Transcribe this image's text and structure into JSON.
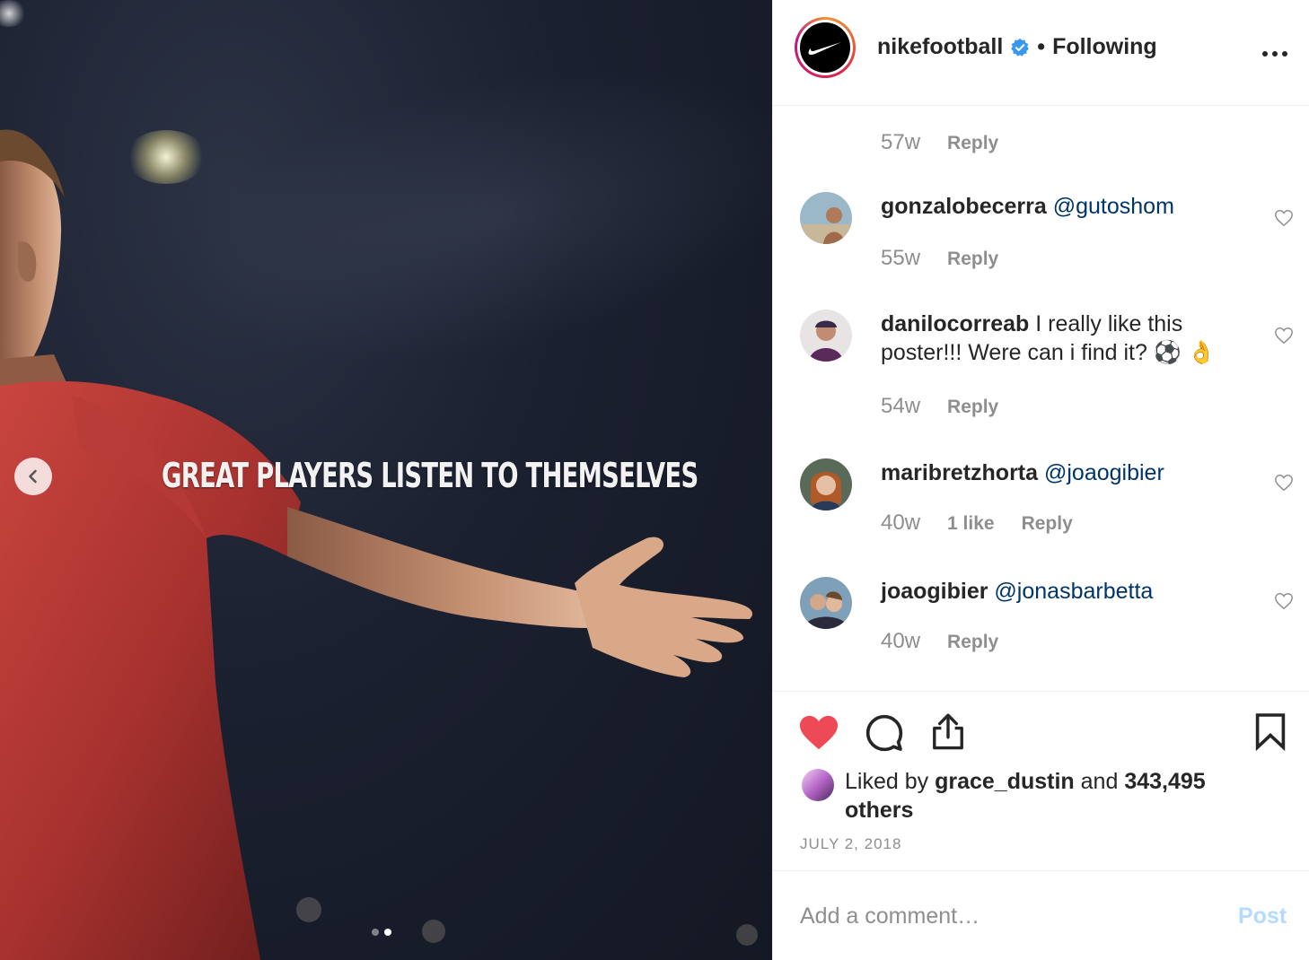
{
  "media": {
    "poster_text": "GREAT PLAYERS LISTEN TO THEMSELVES",
    "prev_icon": "chevron-left-icon",
    "carousel": {
      "count": 2,
      "active_index": 2
    }
  },
  "header": {
    "username": "nikefootball",
    "verified_icon": "verified-badge-icon",
    "separator": "•",
    "follow_status": "Following",
    "more_icon": "more-options-icon"
  },
  "comments": {
    "top_meta": {
      "age": "57w",
      "reply": "Reply"
    },
    "items": [
      {
        "username": "gonzalobecerra",
        "mention": "@gutoshom",
        "text": "",
        "age": "55w",
        "likes": "",
        "reply": "Reply"
      },
      {
        "username": "danilocorreab",
        "mention": "",
        "text": "I really like this poster!!! Were can i find it? ⚽ 👌",
        "age": "54w",
        "likes": "",
        "reply": "Reply"
      },
      {
        "username": "maribretzhorta",
        "mention": "@joaogibier",
        "text": "",
        "age": "40w",
        "likes": "1 like",
        "reply": "Reply"
      },
      {
        "username": "joaogibier",
        "mention": "@jonasbarbetta",
        "text": "",
        "age": "40w",
        "likes": "",
        "reply": "Reply"
      }
    ]
  },
  "actions": {
    "like_icon": "heart-filled-icon",
    "comment_icon": "comment-bubble-icon",
    "share_icon": "share-icon",
    "save_icon": "bookmark-icon",
    "liked_by_prefix": "Liked by",
    "liked_by_user": "grace_dustin",
    "liked_by_and": "and",
    "liked_by_others": "343,495 others",
    "date": "JULY 2, 2018"
  },
  "comment_box": {
    "placeholder": "Add a comment…",
    "post_label": "Post"
  },
  "colors": {
    "like_red": "#ed4956",
    "mention_blue": "#003569",
    "post_disabled": "#b3dbff",
    "verified_blue": "#3897f0",
    "muted_gray": "#8e8e8e"
  }
}
